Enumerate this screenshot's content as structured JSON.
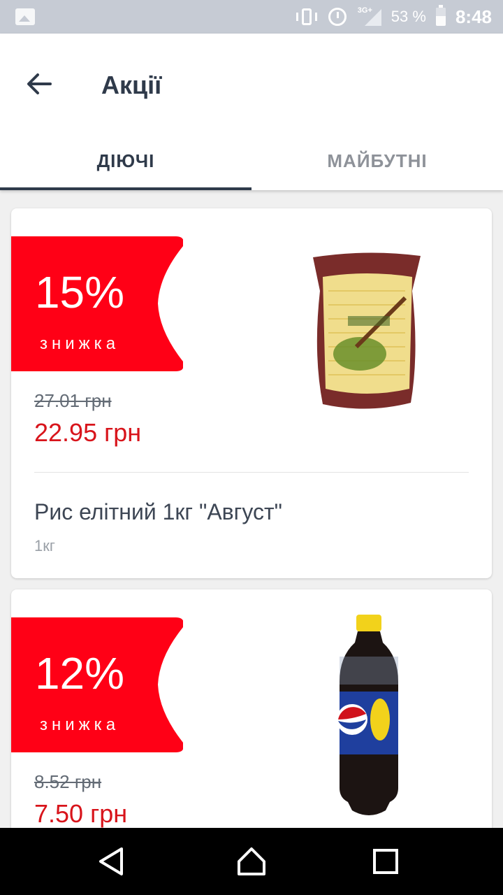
{
  "status_bar": {
    "network_label": "3G+",
    "battery": "53 %",
    "time": "8:48"
  },
  "app_bar": {
    "title": "Акції"
  },
  "tabs": [
    {
      "label": "ДІЮЧІ",
      "active": true
    },
    {
      "label": "МАЙБУТНІ",
      "active": false
    }
  ],
  "colors": {
    "badge_red": "#ff0016",
    "price_red": "#d8141b",
    "title_dark": "#2f3a4a"
  },
  "promotions": [
    {
      "discount": "15%",
      "discount_label": "знижка",
      "old_price": "27.01 грн",
      "new_price": "22.95 грн",
      "name": "Рис елітний 1кг \"Август\"",
      "weight": "1кг",
      "image_icon": "rice-bag-icon"
    },
    {
      "discount": "12%",
      "discount_label": "знижка",
      "old_price": "8.52 грн",
      "new_price": "7.50 грн",
      "image_icon": "pepsi-bottle-icon"
    }
  ]
}
